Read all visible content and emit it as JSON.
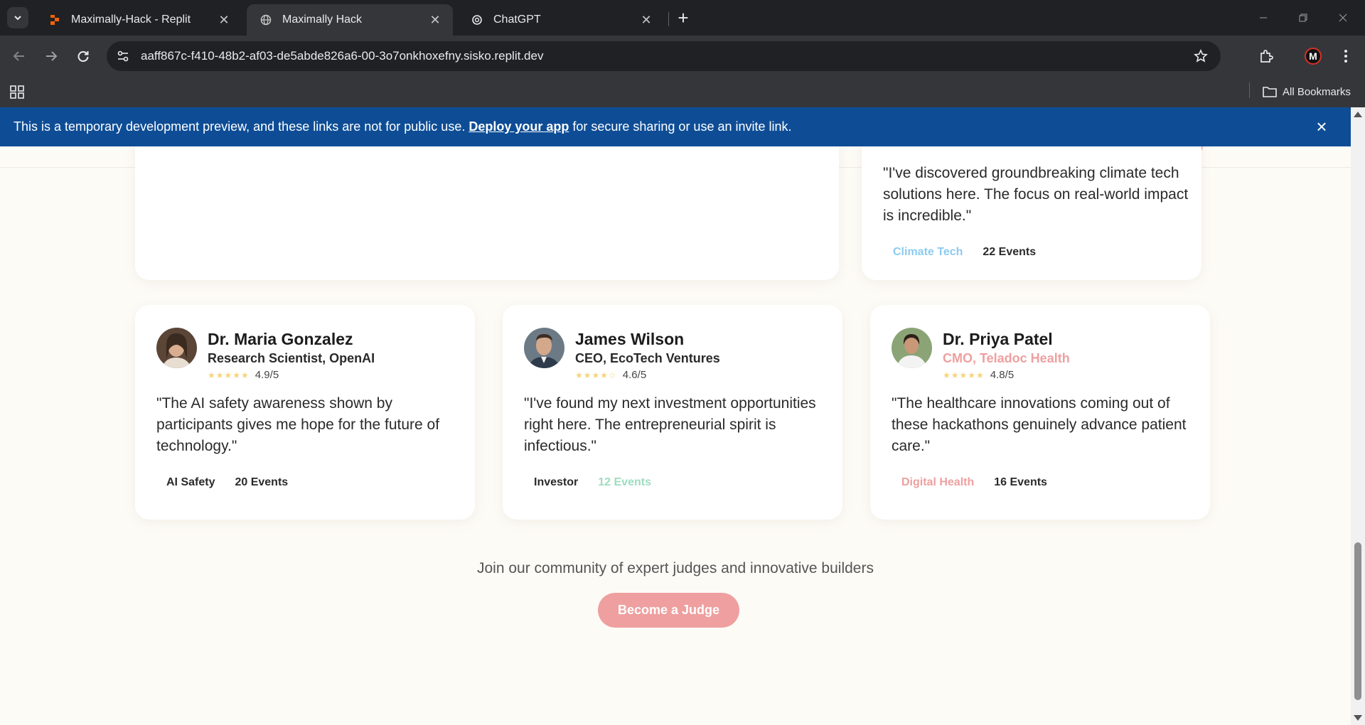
{
  "browser": {
    "tabs": [
      {
        "title": "Maximally-Hack - Replit",
        "favicon": "replit-icon",
        "active": false
      },
      {
        "title": "Maximally Hack",
        "favicon": "globe-icon",
        "active": true
      },
      {
        "title": "ChatGPT",
        "favicon": "chatgpt-icon",
        "active": false
      }
    ],
    "url": "aaff867c-f410-48b2-af03-de5abde826a6-00-3o7onkhoxefny.sisko.replit.dev",
    "profile_initial": "M",
    "all_bookmarks": "All Bookmarks"
  },
  "devbar": {
    "prefix": "This is a temporary development preview, and these links are not for public use.",
    "link": "Deploy your app",
    "suffix": "for secure sharing or use an invite link."
  },
  "top_right_card": {
    "quote": "\"I've discovered groundbreaking climate tech solutions here. The focus on real-world impact is incredible.\"",
    "tag": "Climate Tech",
    "events": "22 Events",
    "tag_color": "#8ccbf0"
  },
  "judges": [
    {
      "name": "Dr. Maria Gonzalez",
      "role": "Research Scientist, OpenAI",
      "stars": "★★★★★",
      "rating": "4.9/5",
      "quote": "\"The AI safety awareness shown by participants gives me hope for the future of technology.\"",
      "tag": "AI Safety",
      "events": "20 Events",
      "role_color": "#2a2a2a",
      "tag_color": "#2a2a2a",
      "events_color": "#2a2a2a"
    },
    {
      "name": "James Wilson",
      "role": "CEO, EcoTech Ventures",
      "stars": "★★★★☆",
      "rating": "4.6/5",
      "quote": "\"I've found my next investment opportunities right here. The entrepreneurial spirit is infectious.\"",
      "tag": "Investor",
      "events": "12 Events",
      "role_color": "#2a2a2a",
      "tag_color": "#2a2a2a",
      "events_color": "#9ddcc0"
    },
    {
      "name": "Dr. Priya Patel",
      "role": "CMO, Teladoc Health",
      "stars": "★★★★★",
      "rating": "4.8/5",
      "quote": "\"The healthcare innovations coming out of these hackathons genuinely advance patient care.\"",
      "tag": "Digital Health",
      "events": "16 Events",
      "role_color": "#ef9f9f",
      "tag_color": "#ef9f9f",
      "events_color": "#2a2a2a"
    }
  ],
  "cta": {
    "text": "Join our community of expert judges and innovative builders",
    "button": "Become a Judge"
  },
  "colors": {
    "accent": "#ef9f9f",
    "devbar": "#0e4d96",
    "page_bg": "#fdfbf6"
  }
}
